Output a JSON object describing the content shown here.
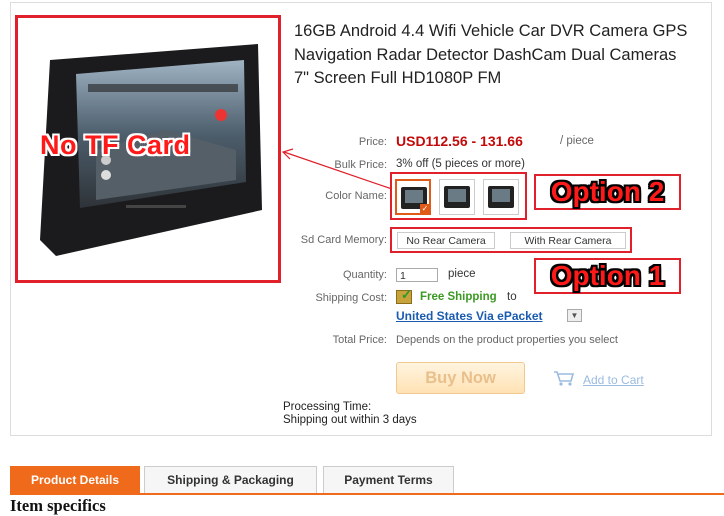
{
  "product": {
    "title": "16GB Android 4.4 Wifi Vehicle Car DVR Camera GPS Navigation Radar Detector DashCam Dual Cameras 7\" Screen Full HD1080P FM",
    "image_overlay_text": "No TF Card"
  },
  "fields": {
    "price_label": "Price:",
    "price_value": "USD112.56 - 131.66",
    "price_unit": "/ piece",
    "bulk_label": "Bulk Price:",
    "bulk_value": "3% off (5 pieces or more)",
    "color_label": "Color Name:",
    "sd_label": "Sd Card Memory:",
    "sd_options": [
      "No Rear Camera",
      "With Rear Camera"
    ],
    "qty_label": "Quantity:",
    "qty_value": "1",
    "qty_unit": "piece",
    "shipping_label": "Shipping Cost:",
    "shipping_free": "Free Shipping",
    "shipping_to": "to",
    "shipping_dest": "United States Via ePacket",
    "total_label": "Total Price:",
    "total_value": "Depends on the product properties you select"
  },
  "annotations": {
    "option2": "Option 2",
    "option1": "Option 1"
  },
  "actions": {
    "buy_now": "Buy Now",
    "add_to_cart": "Add to Cart"
  },
  "processing": {
    "label": "Processing Time:",
    "value": "Shipping out within 3 days"
  },
  "tabs": [
    "Product Details",
    "Shipping & Packaging",
    "Payment Terms"
  ],
  "section_heading": "Item specifics",
  "colors": {
    "price_red": "#c30a0a",
    "annotation_red": "#e0202a",
    "free_shipping_green": "#3a9a22",
    "link_blue": "#1a5bb0",
    "tab_active": "#ef6a1a"
  },
  "icons": {
    "shipping": "shipping-box-check-icon",
    "cart": "shopping-cart-icon",
    "dropdown": "chevron-down-icon"
  }
}
